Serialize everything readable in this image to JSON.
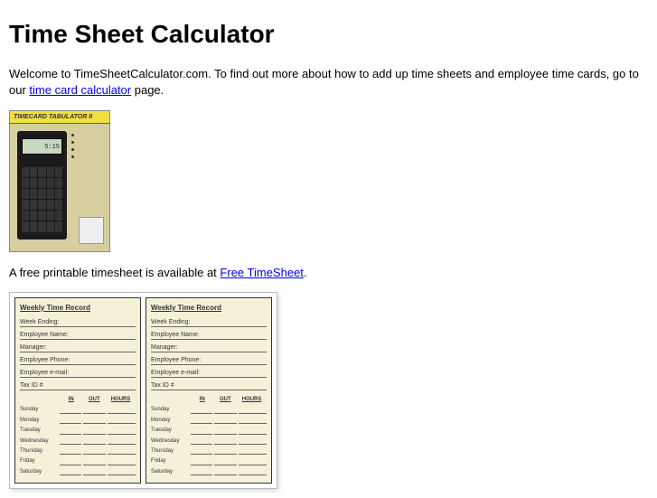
{
  "page_title": "Time Sheet Calculator",
  "intro": {
    "text_before_link": "Welcome to TimeSheetCalculator.com. To find out more about how to add up time sheets and employee time cards, go to our ",
    "link_text": "time card calculator",
    "text_after_link": " page."
  },
  "calculator_image": {
    "header": "TIMECARD TABULATOR II",
    "screen_value": "5:15"
  },
  "second_paragraph": {
    "text_before_link": "A free printable timesheet is available at ",
    "link_text": "Free TimeSheet",
    "text_after_link": "."
  },
  "timesheet": {
    "title": "Weekly Time Record",
    "fields": [
      "Week Ending:",
      "Employee Name:",
      "Manager:",
      "Employee Phone:",
      "Employee e-mail:",
      "Tax ID #"
    ],
    "columns": [
      "",
      "IN",
      "OUT",
      "HOURS"
    ],
    "days": [
      "Sunday",
      "Monday",
      "Tuesday",
      "Wednesday",
      "Thursday",
      "Friday",
      "Saturday"
    ]
  }
}
